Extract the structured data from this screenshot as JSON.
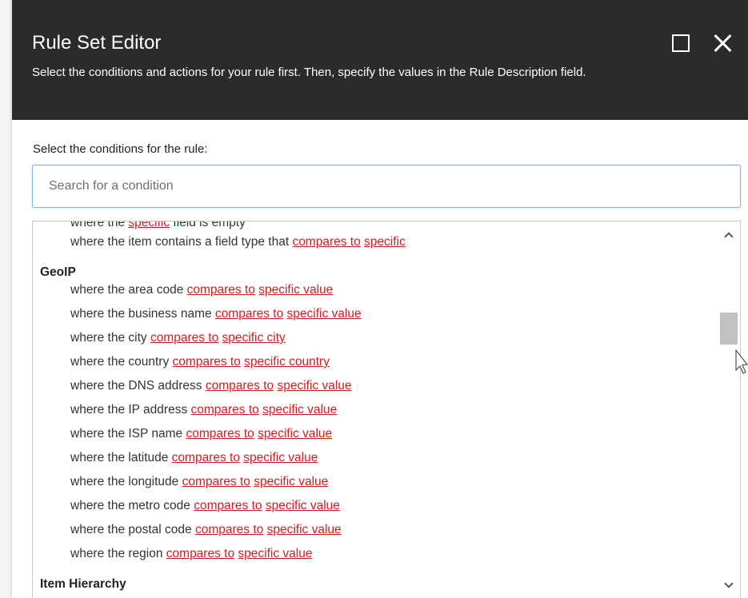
{
  "dialog": {
    "title": "Rule Set Editor",
    "subtitle": "Select the conditions and actions for your rule first. Then, specify the values in the Rule Description field.",
    "maximize_icon": "maximize-icon",
    "close_icon": "close-icon"
  },
  "conditions": {
    "label": "Select the conditions for the rule:",
    "search_placeholder": "Search for a condition",
    "search_value": ""
  },
  "list": {
    "partial_row": {
      "prefix": "where the ",
      "link1": "specific",
      "suffix": " field is empty"
    },
    "top_row": {
      "prefix": "where the item contains a field type that ",
      "link1": "compares to",
      "link2": "specific"
    },
    "geoip": {
      "title": "GeoIP",
      "items": [
        {
          "prefix": "where the area code ",
          "link1": "compares to",
          "link2": "specific value"
        },
        {
          "prefix": "where the business name ",
          "link1": "compares to",
          "link2": "specific value"
        },
        {
          "prefix": "where the city ",
          "link1": "compares to",
          "link2": "specific city"
        },
        {
          "prefix": "where the country ",
          "link1": "compares to",
          "link2": "specific country"
        },
        {
          "prefix": "where the DNS address ",
          "link1": "compares to",
          "link2": "specific value"
        },
        {
          "prefix": "where the IP address ",
          "link1": "compares to",
          "link2": "specific value"
        },
        {
          "prefix": "where the ISP name ",
          "link1": "compares to",
          "link2": "specific value"
        },
        {
          "prefix": "where the latitude ",
          "link1": "compares to",
          "link2": "specific value"
        },
        {
          "prefix": "where the longitude ",
          "link1": "compares to",
          "link2": "specific value"
        },
        {
          "prefix": "where the metro code ",
          "link1": "compares to",
          "link2": "specific value"
        },
        {
          "prefix": "where the postal code ",
          "link1": "compares to",
          "link2": "specific value"
        },
        {
          "prefix": "where the region ",
          "link1": "compares to",
          "link2": "specific value"
        }
      ]
    },
    "next_category": {
      "title": "Item Hierarchy"
    }
  },
  "scrollbar": {
    "up_icon": "chevron-up-icon",
    "down_icon": "chevron-down-icon"
  },
  "colors": {
    "header_bg": "#2b2b2b",
    "link": "#d11f1f",
    "input_border": "#7ab3e6"
  }
}
